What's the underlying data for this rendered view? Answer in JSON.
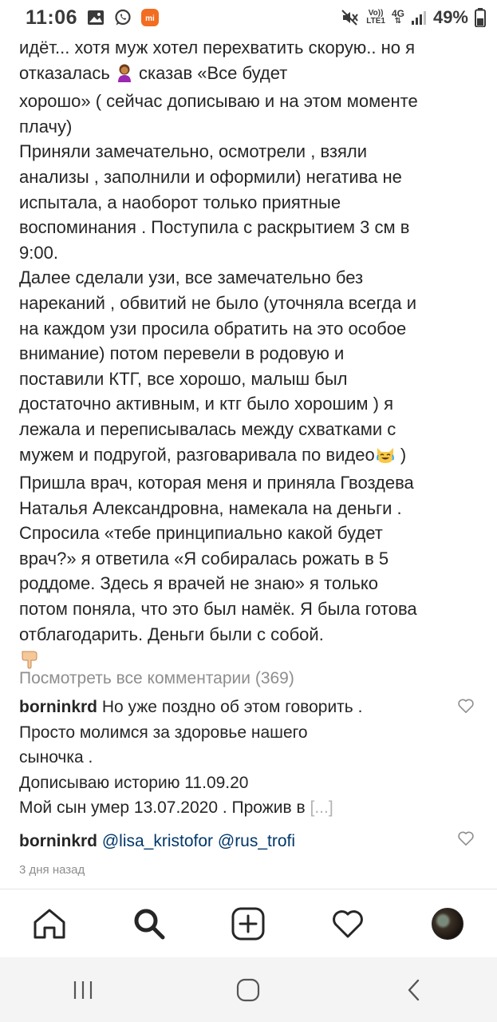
{
  "status_bar": {
    "time": "11:06",
    "net_top": "Vo))",
    "net_bottom": "LTE1",
    "gen": "4G",
    "battery": "49%"
  },
  "caption": {
    "line1": "идёт... хотя муж хотел перехватить скорую.. но я",
    "line2a": "отказалась",
    "line2b": "сказав «Все будет",
    "line3": "хорошо» ( сейчас дописываю и на этом моменте",
    "line4": "плачу)",
    "para2": [
      "Приняли замечательно, осмотрели , взяли",
      "анализы , заполнили и оформили) негатива не",
      "испытала, а наоборот только приятные",
      "воспоминания . Поступила с раскрытием 3 см в",
      "9:00."
    ],
    "para3": [
      "Далее сделали узи, все замечательно без",
      "нареканий , обвитий не было (уточняла всегда и",
      "на каждом узи просила обратить на это особое",
      "внимание) потом перевели в родовую и",
      "поставили КТГ, все хорошо, малыш был",
      "достаточно активным, и ктг было хорошим ) я",
      "лежала и переписывалась между схватками с"
    ],
    "line_video_a": "мужем и подругой, разговаривала по видео",
    "line_video_b": ")",
    "para4": [
      "Пришла врач, которая меня и приняла Гвоздева",
      "Наталья Александровна, намекала на деньги .",
      "Спросила «тебе принципиально какой будет",
      "врач?» я ответила «Я собиралась рожать в 5",
      "роддоме. Здесь я врачей не знаю» я только",
      "потом поняла, что это был намёк. Я была готова",
      "отблагодарить. Деньги были с собой."
    ]
  },
  "view_all_comments": "Посмотреть все комментарии (369)",
  "comments": [
    {
      "username": "borninkrd",
      "lines": [
        "Но уже поздно об этом говорить .",
        "Просто молимся за здоровье нашего",
        "сыночка .",
        "Дописываю историю 11.09.20"
      ],
      "last_line": "Мой сын умер 13.07.2020 . Прожив в",
      "more": "[...]"
    },
    {
      "username": "borninkrd",
      "mention1": "@lisa_kristofor",
      "mention2": "@rus_trofi"
    }
  ],
  "timestamp": "3 дня назад",
  "icons": {
    "status": [
      "gallery-icon",
      "whatsapp-icon",
      "mi-icon",
      "mute-icon",
      "signal-icon",
      "battery-icon"
    ],
    "bottom_nav": [
      "home-icon",
      "search-icon",
      "new-post-icon",
      "activity-heart-icon",
      "profile-avatar"
    ],
    "system_nav": [
      "recents-icon",
      "home-circle-icon",
      "back-icon"
    ]
  },
  "colors": {
    "text": "#262626",
    "secondary": "#8e8e8e",
    "mention": "#00376b",
    "mi_orange": "#f26d21"
  }
}
